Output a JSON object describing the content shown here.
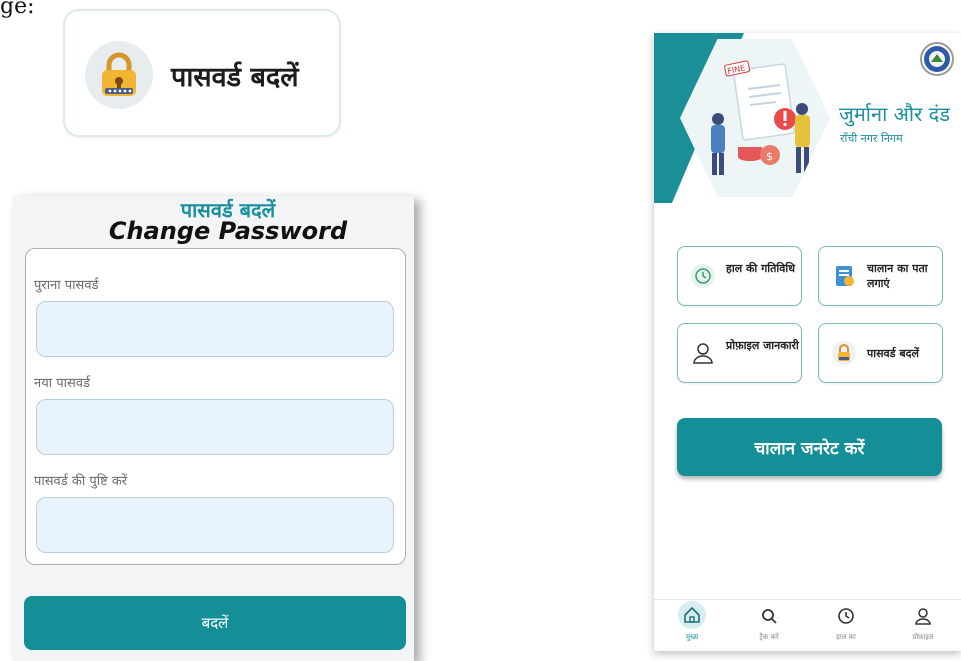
{
  "doc_fragment": "ge:",
  "callout": {
    "label": "पासवर्ड बदलें"
  },
  "change_password": {
    "title_hindi": "पासवर्ड बदलें",
    "title_english": "Change Password",
    "fields": [
      {
        "label": "पुराना पासवर्ड",
        "value": ""
      },
      {
        "label": "नया पासवर्ड",
        "value": ""
      },
      {
        "label": "पासवर्ड की पुष्टि करें",
        "value": ""
      }
    ],
    "submit_label": "बदलें"
  },
  "app": {
    "title": "जुर्माना और दंड",
    "subtitle": "राँची नगर निगम",
    "illustration_text": "FINE",
    "tiles": [
      {
        "label": "हाल की गतिविधि",
        "icon": "clock-history-icon"
      },
      {
        "label": "चालान का पता लगाएं",
        "icon": "document-search-icon"
      },
      {
        "label": "प्रोफ़ाइल जानकारी",
        "icon": "user-profile-icon"
      },
      {
        "label": "पासवर्ड बदलें",
        "icon": "lock-icon"
      }
    ],
    "generate_label": "चालान जनरेट करें",
    "nav": [
      {
        "label": "मुख्य",
        "icon": "home-icon",
        "active": true
      },
      {
        "label": "ट्रैक करें",
        "icon": "search-icon",
        "active": false
      },
      {
        "label": "हाल का",
        "icon": "clock-icon",
        "active": false
      },
      {
        "label": "प्रोफ़ाइल",
        "icon": "user-icon",
        "active": false
      }
    ]
  },
  "colors": {
    "accent": "#148f98",
    "accent_text": "#1a8f9d",
    "input_fill": "#e8f3fb",
    "lock_yellow": "#f2b632"
  }
}
